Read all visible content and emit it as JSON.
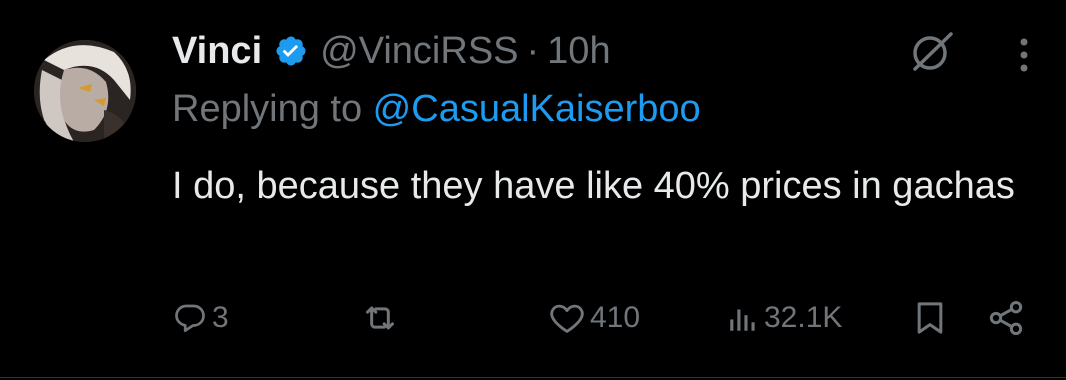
{
  "tweet": {
    "display_name": "Vinci",
    "handle": "@VinciRSS",
    "separator": "·",
    "time": "10h",
    "reply_prefix": "Replying to ",
    "reply_target": "@CasualKaiserboo",
    "text": "I do, because they have like 40% prices in gachas"
  },
  "actions": {
    "replies": "3",
    "retweets": "",
    "likes": "410",
    "views": "32.1K"
  },
  "icons": {
    "verified": "verified-badge-icon",
    "grok": "grok-icon",
    "more": "more-options-icon",
    "reply": "reply-icon",
    "retweet": "retweet-icon",
    "like": "heart-icon",
    "views": "views-icon",
    "bookmark": "bookmark-icon",
    "share": "share-icon"
  },
  "colors": {
    "background": "#000000",
    "text": "#e7e9ea",
    "muted": "#71767b",
    "accent": "#1d9bf0"
  }
}
